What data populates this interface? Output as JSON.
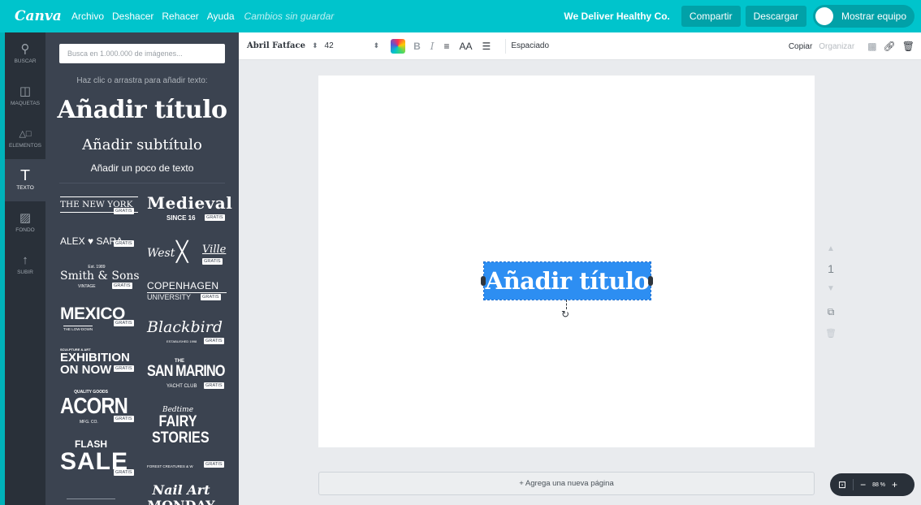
{
  "topbar": {
    "logo": "Canva",
    "menu": [
      "Archivo",
      "Deshacer",
      "Rehacer",
      "Ayuda"
    ],
    "status": "Cambios sin guardar",
    "team_name": "We Deliver Healthy Co.",
    "share": "Compartir",
    "download": "Descargar",
    "show_team": "Mostrar equipo"
  },
  "rail": [
    {
      "label": "BUSCAR",
      "icon": "search-icon",
      "glyph": "⚲"
    },
    {
      "label": "MAQUETAS",
      "icon": "layouts-icon",
      "glyph": "◫"
    },
    {
      "label": "ELEMENTOS",
      "icon": "elements-icon",
      "glyph": "△□"
    },
    {
      "label": "TEXTO",
      "icon": "text-icon",
      "glyph": "T"
    },
    {
      "label": "FONDO",
      "icon": "background-icon",
      "glyph": "▨"
    },
    {
      "label": "SUBIR",
      "icon": "upload-icon",
      "glyph": "↑"
    }
  ],
  "panel": {
    "search_placeholder": "Busca en 1.000.000 de imágenes...",
    "hint": "Haz clic o arrastra para añadir texto:",
    "add_title": "Añadir título",
    "add_subtitle": "Añadir subtítulo",
    "add_text": "Añadir un poco de texto",
    "badge": "GRATIS",
    "templates": {
      "new_york": "THE NEW YORK",
      "medieval": "Medieval",
      "medieval_sub": "SINCE 16",
      "alex": "ALEX ♥ SARA",
      "west": "West",
      "ville": "Ville",
      "smith_est": "Est. 1989",
      "smith": "Smith & Sons",
      "smith_sub": "VINTAGE",
      "copenhagen": "COPENHAGEN",
      "copenhagen_sub": "UNIVERSITY",
      "mexico": "MEXICO",
      "mexico_sub": "THE LOW-DOWN",
      "blackbird": "Blackbird",
      "blackbird_sub": "ESTABLISHED 1998",
      "exhibition_pre": "SCULPTURE & ART",
      "exhibition": "EXHIBITION",
      "exhibition2": "ON NOW",
      "san_marino_pre": "THE",
      "san_marino": "SAN MARINO",
      "san_marino_sub": "YACHT CLUB",
      "acorn_pre": "QUALITY GOODS",
      "acorn": "ACORN",
      "acorn_sub": "MFG. CO.",
      "fairy_pre": "Bedtime",
      "fairy": "FAIRY",
      "fairy2": "STORIES",
      "fairy_sub": "FOREST CREATURES & W",
      "flash": "FLASH",
      "sale": "SALE",
      "nail": "Nail Art",
      "nail2": "MONDAY"
    }
  },
  "toolbar": {
    "font": "Abril Fatface",
    "size": "42",
    "bold": "B",
    "italic": "I",
    "align": "≡",
    "case": "AA",
    "list": "☰",
    "spacing": "Espaciado",
    "copy": "Copiar",
    "arrange": "Organizar"
  },
  "canvas": {
    "selected_text": "Añadir título",
    "page_number": "1",
    "add_page": "+ Agrega una nueva página"
  },
  "zoom": {
    "minus": "−",
    "level": "88 %",
    "plus": "+"
  },
  "colors": {
    "brand": "#00c4cc",
    "panel": "#3b4350",
    "rail": "#293039",
    "selection": "#2d8ef2"
  }
}
